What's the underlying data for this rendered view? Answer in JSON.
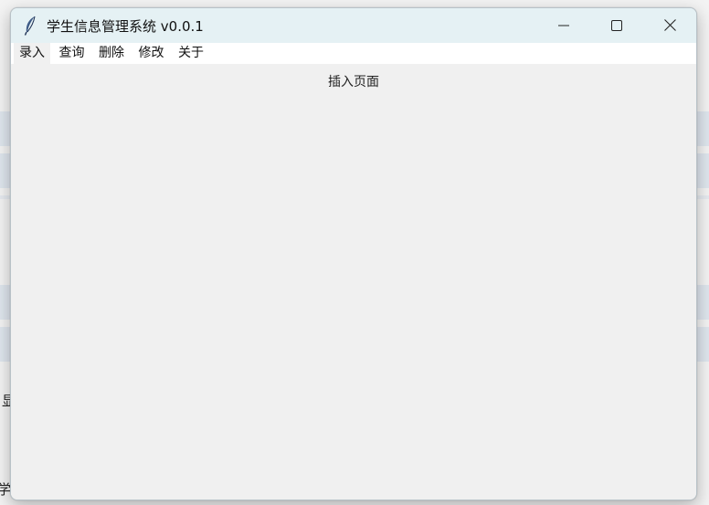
{
  "window": {
    "title": "学生信息管理系统 v0.0.1"
  },
  "menu": {
    "items": [
      {
        "label": "录入"
      },
      {
        "label": "查询"
      },
      {
        "label": "删除"
      },
      {
        "label": "修改"
      },
      {
        "label": "关于"
      }
    ]
  },
  "content": {
    "label": "插入页面"
  },
  "background": {
    "text_1": "显",
    "text_2": "学"
  },
  "icons": {
    "app": "feather-icon",
    "minimize": "minimize-icon",
    "maximize": "maximize-icon",
    "close": "close-icon"
  }
}
